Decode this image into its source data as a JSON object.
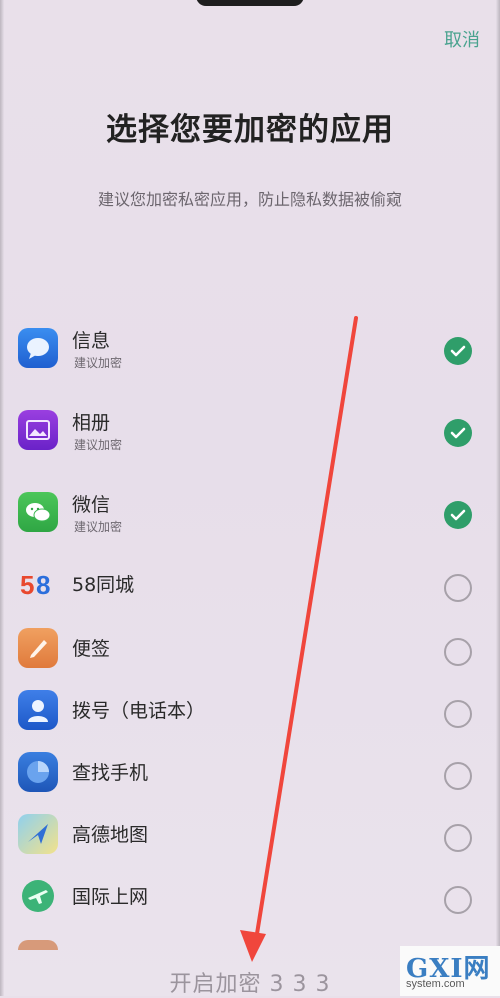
{
  "header": {
    "cancel_label": "取消",
    "title": "选择您要加密的应用",
    "subtitle": "建议您加密私密应用，防止隐私数据被偷窥"
  },
  "apps": [
    {
      "name": "信息",
      "sub": "建议加密",
      "checked": true,
      "icon": "message-icon"
    },
    {
      "name": "相册",
      "sub": "建议加密",
      "checked": true,
      "icon": "gallery-icon"
    },
    {
      "name": "微信",
      "sub": "建议加密",
      "checked": true,
      "icon": "wechat-icon"
    },
    {
      "name": "58同城",
      "sub": "",
      "checked": false,
      "icon": "58-icon"
    },
    {
      "name": "便签",
      "sub": "",
      "checked": false,
      "icon": "notes-icon"
    },
    {
      "name": "拨号（电话本）",
      "sub": "",
      "checked": false,
      "icon": "contacts-icon"
    },
    {
      "name": "查找手机",
      "sub": "",
      "checked": false,
      "icon": "find-phone-icon"
    },
    {
      "name": "高德地图",
      "sub": "",
      "checked": false,
      "icon": "amap-icon"
    },
    {
      "name": "国际上网",
      "sub": "",
      "checked": false,
      "icon": "global-internet-icon"
    }
  ],
  "footer": {
    "button_label": "开启加密 3 3 3"
  },
  "watermark": {
    "logo_text": "GXI网",
    "url": "system.com"
  },
  "colors": {
    "accent": "#2f9e6a",
    "cancel": "#4aa38f",
    "annotation_arrow": "#f0463c"
  }
}
